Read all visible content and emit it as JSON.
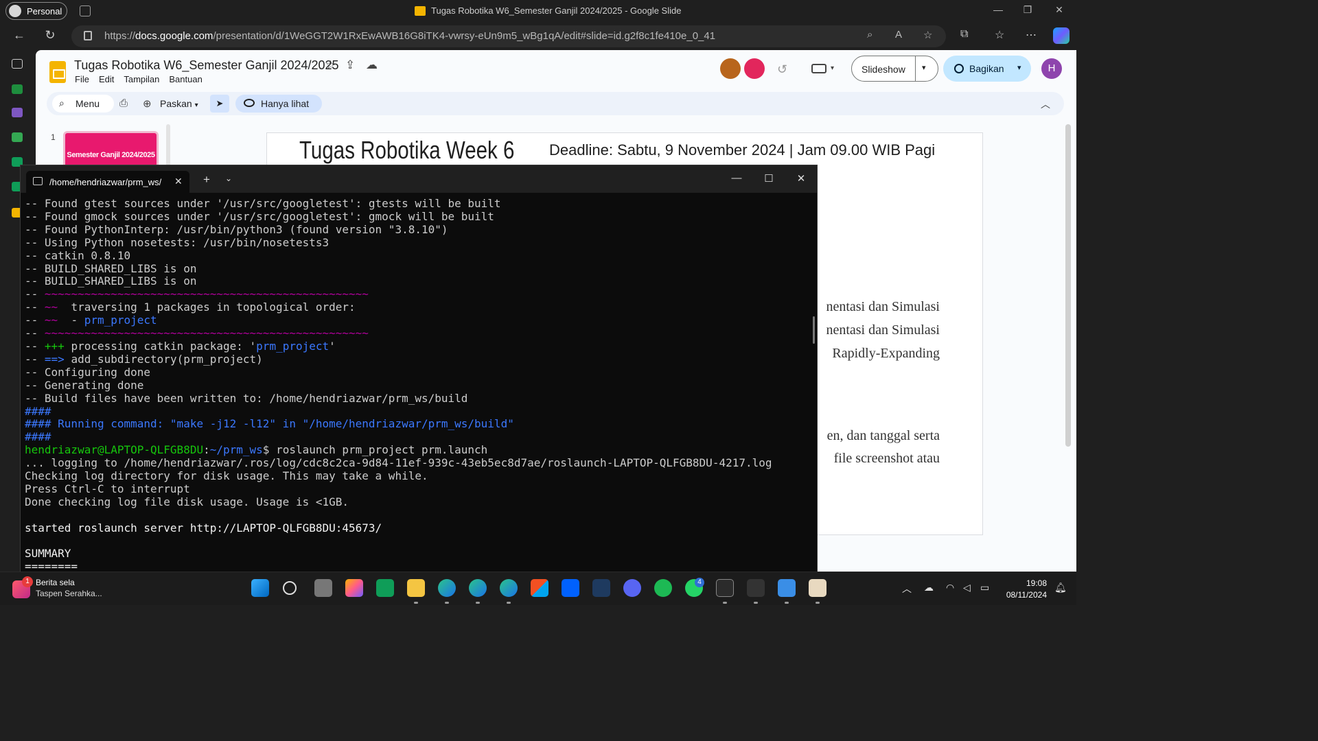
{
  "browser": {
    "profile_label": "Personal",
    "window_title": "Tugas Robotika W6_Semester Ganjil 2024/2025 - Google Slide",
    "url_prefix": "https://",
    "url_domain": "docs.google.com",
    "url_path": "/presentation/d/1WeGGT2W1RxEwAWB16G8iTK4-vwrsy-eUn9m5_wBg1qA/edit#slide=id.g2f8c1fe410e_0_41"
  },
  "slides_app": {
    "doc_title": "Tugas Robotika W6_Semester Ganjil 2024/2025",
    "menu": [
      "File",
      "Edit",
      "Tampilan",
      "Bantuan"
    ],
    "slideshow_label": "Slideshow",
    "share_label": "Bagikan",
    "user_initial": "H",
    "toolbar": {
      "search_label": "Menu",
      "zoom_label": "Paskan",
      "view_only_label": "Hanya lihat"
    },
    "filmstrip": {
      "slide_number": "1",
      "thumb_text": "Semester Ganjil 2024/2025"
    },
    "slide": {
      "title": "Tugas Robotika Week 6",
      "deadline": "Deadline: Sabtu, 9 November 2024  | Jam 09.00 WIB Pagi",
      "lines": [
        "nentasi dan Simulasi",
        "nentasi dan Simulasi",
        "Rapidly-Expanding",
        "en, dan tanggal serta",
        "file screenshot atau"
      ]
    }
  },
  "terminal": {
    "tab_title": "/home/hendriazwar/prm_ws/",
    "lines": [
      {
        "segments": [
          {
            "t": "-- Found gtest sources under '/usr/src/googletest': gtests will be built",
            "c": ""
          }
        ]
      },
      {
        "segments": [
          {
            "t": "-- Found gmock sources under '/usr/src/googletest': gmock will be built",
            "c": ""
          }
        ]
      },
      {
        "segments": [
          {
            "t": "-- Found PythonInterp: /usr/bin/python3 (found version \"3.8.10\")",
            "c": ""
          }
        ]
      },
      {
        "segments": [
          {
            "t": "-- Using Python nosetests: /usr/bin/nosetests3",
            "c": ""
          }
        ]
      },
      {
        "segments": [
          {
            "t": "-- catkin 0.8.10",
            "c": ""
          }
        ]
      },
      {
        "segments": [
          {
            "t": "-- BUILD_SHARED_LIBS is on",
            "c": ""
          }
        ]
      },
      {
        "segments": [
          {
            "t": "-- BUILD_SHARED_LIBS is on",
            "c": ""
          }
        ]
      },
      {
        "segments": [
          {
            "t": "-- ",
            "c": ""
          },
          {
            "t": "~~~~~~~~~~~~~~~~~~~~~~~~~~~~~~~~~~~~~~~~~~~~~~~~~",
            "c": "c-mag"
          }
        ]
      },
      {
        "segments": [
          {
            "t": "-- ",
            "c": ""
          },
          {
            "t": "~~",
            "c": "c-mag"
          },
          {
            "t": "  traversing 1 packages in topological order:",
            "c": ""
          }
        ]
      },
      {
        "segments": [
          {
            "t": "-- ",
            "c": ""
          },
          {
            "t": "~~",
            "c": "c-mag"
          },
          {
            "t": "  - ",
            "c": ""
          },
          {
            "t": "prm_project",
            "c": "c-blu"
          }
        ]
      },
      {
        "segments": [
          {
            "t": "-- ",
            "c": ""
          },
          {
            "t": "~~~~~~~~~~~~~~~~~~~~~~~~~~~~~~~~~~~~~~~~~~~~~~~~~",
            "c": "c-mag"
          }
        ]
      },
      {
        "segments": [
          {
            "t": "-- ",
            "c": ""
          },
          {
            "t": "+++",
            "c": "c-grn"
          },
          {
            "t": " processing catkin package: '",
            "c": ""
          },
          {
            "t": "prm_project",
            "c": "c-blu"
          },
          {
            "t": "'",
            "c": ""
          }
        ]
      },
      {
        "segments": [
          {
            "t": "-- ",
            "c": ""
          },
          {
            "t": "==>",
            "c": "c-blu"
          },
          {
            "t": " add_subdirectory(prm_project)",
            "c": ""
          }
        ]
      },
      {
        "segments": [
          {
            "t": "-- Configuring done",
            "c": ""
          }
        ]
      },
      {
        "segments": [
          {
            "t": "-- Generating done",
            "c": ""
          }
        ]
      },
      {
        "segments": [
          {
            "t": "-- Build files have been written to: /home/hendriazwar/prm_ws/build",
            "c": ""
          }
        ]
      },
      {
        "segments": [
          {
            "t": "####",
            "c": "c-blu"
          }
        ]
      },
      {
        "segments": [
          {
            "t": "#### Running command: ",
            "c": "c-blu"
          },
          {
            "t": "\"make -j12 -l12\"",
            "c": "c-blu"
          },
          {
            "t": " in ",
            "c": "c-blu"
          },
          {
            "t": "\"/home/hendriazwar/prm_ws/build\"",
            "c": "c-blu"
          }
        ]
      },
      {
        "segments": [
          {
            "t": "####",
            "c": "c-blu"
          }
        ]
      },
      {
        "segments": [
          {
            "t": "hendriazwar@LAPTOP-QLFGB8DU",
            "c": "c-prompt-user"
          },
          {
            "t": ":",
            "c": ""
          },
          {
            "t": "~/prm_ws",
            "c": "c-prompt-path"
          },
          {
            "t": "$ roslaunch prm_project prm.launch",
            "c": ""
          }
        ]
      },
      {
        "segments": [
          {
            "t": "... logging to /home/hendriazwar/.ros/log/cdc8c2ca-9d84-11ef-939c-43eb5ec8d7ae/roslaunch-LAPTOP-QLFGB8DU-4217.log",
            "c": ""
          }
        ]
      },
      {
        "segments": [
          {
            "t": "Checking log directory for disk usage. This may take a while.",
            "c": ""
          }
        ]
      },
      {
        "segments": [
          {
            "t": "Press Ctrl-C to interrupt",
            "c": ""
          }
        ]
      },
      {
        "segments": [
          {
            "t": "Done checking log file disk usage. Usage is <1GB.",
            "c": ""
          }
        ]
      },
      {
        "segments": [
          {
            "t": "",
            "c": ""
          }
        ]
      },
      {
        "segments": [
          {
            "t": "started roslaunch server http://LAPTOP-QLFGB8DU:45673/",
            "c": "c-white"
          }
        ]
      },
      {
        "segments": [
          {
            "t": "",
            "c": ""
          }
        ]
      },
      {
        "segments": [
          {
            "t": "SUMMARY",
            "c": "c-white"
          }
        ]
      },
      {
        "segments": [
          {
            "t": "========",
            "c": "c-white"
          }
        ]
      }
    ]
  },
  "taskbar": {
    "news_title": "Berita sela",
    "news_subtitle": "Taspen Serahka...",
    "news_badge": "1",
    "whatsapp_badge": "4",
    "time": "19:08",
    "date": "08/11/2024"
  }
}
